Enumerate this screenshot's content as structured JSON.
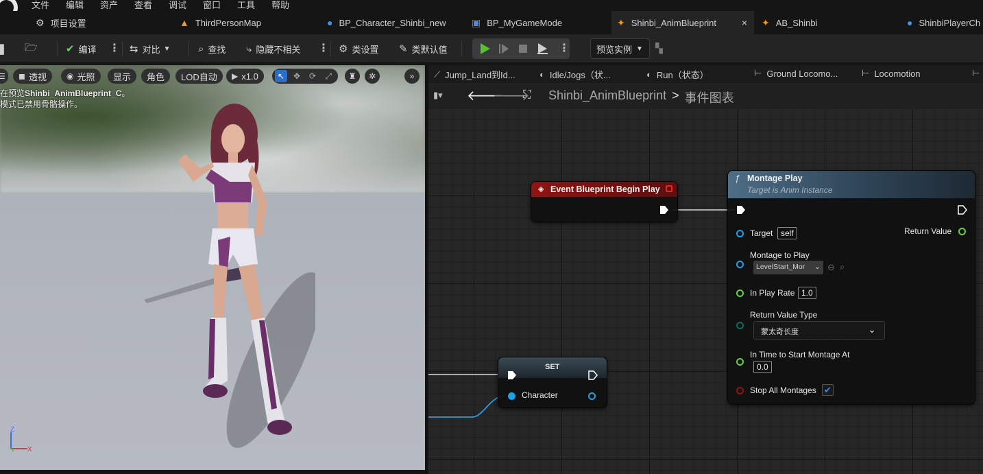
{
  "menu": [
    "文件",
    "编辑",
    "资产",
    "查看",
    "调试",
    "窗口",
    "工具",
    "帮助"
  ],
  "tabs": [
    {
      "label": "项目设置",
      "icon": "settings-icon"
    },
    {
      "label": "ThirdPersonMap",
      "icon": "level-icon"
    },
    {
      "label": "BP_Character_Shinbi_new",
      "icon": "character-icon"
    },
    {
      "label": "BP_MyGameMode",
      "icon": "blueprint-icon"
    },
    {
      "label": "Shinbi_AnimBlueprint",
      "icon": "anim-blueprint-icon",
      "active": true,
      "close": "×"
    },
    {
      "label": "AB_Shinbi",
      "icon": "anim-blueprint-icon"
    },
    {
      "label": "ShinbiPlayerCh",
      "icon": "character-icon"
    }
  ],
  "toolbar": {
    "compile": "编译",
    "diff": "对比",
    "find": "查找",
    "hide_unrelated": "隐藏不相关",
    "class_settings": "类设置",
    "class_defaults": "类默认值",
    "preview_instance": "预览实例"
  },
  "viewport": {
    "perspective": "透视",
    "lighting": "光照",
    "show": "显示",
    "character": "角色",
    "lod": "LOD自动",
    "speed": "x1.0",
    "info_prefix": "在预览",
    "info_bold": "Shinbi_AnimBlueprint_C",
    "info_suffix": "。",
    "info_line2": "模式已禁用骨骼操作。",
    "axis_z": "Z",
    "axis_x": "X"
  },
  "graph_tabs": [
    {
      "label": "Jump_Land到Id...",
      "icon": "transition-icon"
    },
    {
      "label": "Idle/Jogs（状...",
      "icon": "state-icon"
    },
    {
      "label": "Run（状态）",
      "icon": "state-icon"
    },
    {
      "label": "Ground Locomo...",
      "icon": "state-machine-icon"
    },
    {
      "label": "Locomotion",
      "icon": "state-machine-icon"
    }
  ],
  "breadcrumb": {
    "blueprint": "Shinbi_AnimBlueprint",
    "separator": ">",
    "graph": "事件图表"
  },
  "nodes": {
    "begin_play": {
      "title": "Event Blueprint Begin Play"
    },
    "montage_play": {
      "title": "Montage Play",
      "subtitle": "Target is Anim Instance",
      "target": "Target",
      "target_value": "self",
      "return_value": "Return Value",
      "montage_to_play": "Montage to Play",
      "montage_value": "LevelStart_Mor",
      "in_play_rate": "In Play Rate",
      "play_rate_value": "1.0",
      "return_value_type": "Return Value Type",
      "return_value_type_value": "蒙太奇长度",
      "in_time": "In Time to Start Montage At",
      "in_time_value": "0.0",
      "stop_all": "Stop All Montages",
      "stop_all_checked": true
    },
    "set": {
      "title": "SET",
      "character": "Character"
    }
  },
  "colors": {
    "exec": "#ffffff",
    "object_pin": "#1fa1e6",
    "float_pin": "#63d33d",
    "enum_pin": "#0e6b5e",
    "bool_pin": "#941212",
    "event_header": "#8e1513",
    "function_header": "#4e6d86",
    "play_green": "#55c22d"
  }
}
